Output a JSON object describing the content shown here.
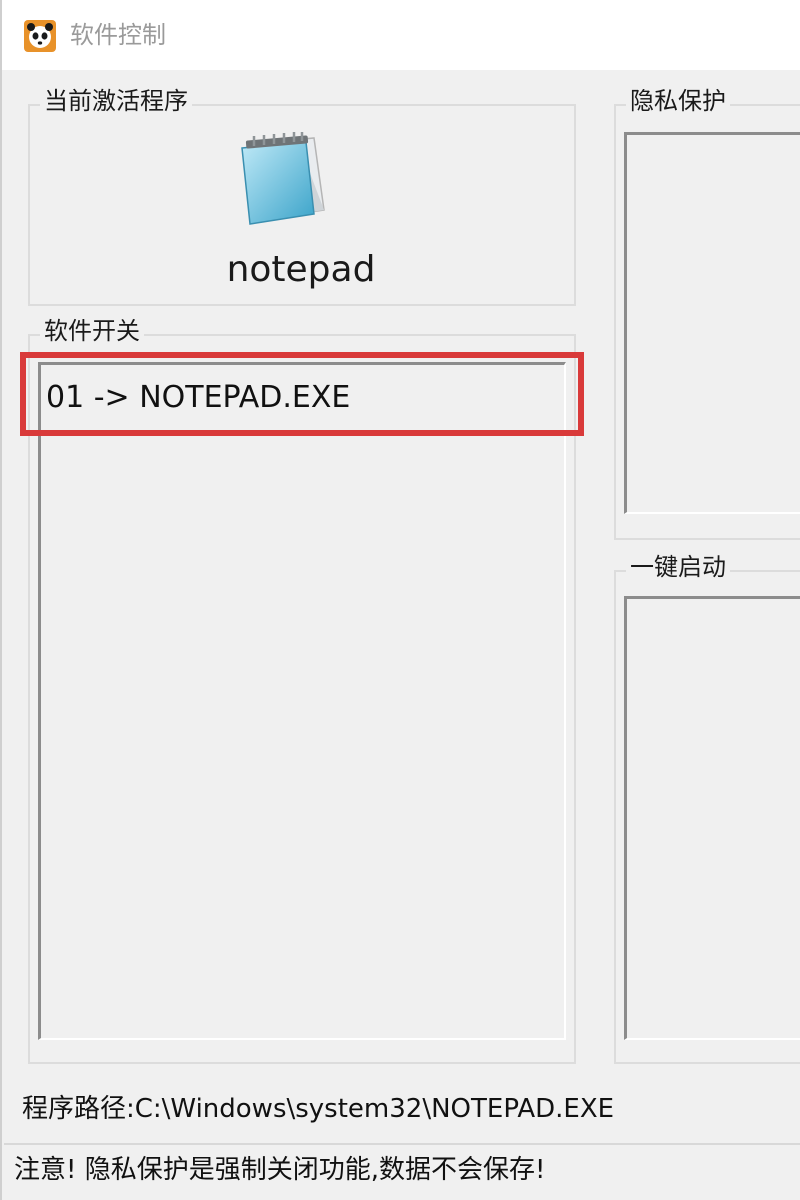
{
  "window": {
    "title": "软件控制",
    "icon": "panda-logo-icon"
  },
  "current_program": {
    "group_label": "当前激活程序",
    "icon": "notepad-icon",
    "name": "notepad"
  },
  "software_switch": {
    "group_label": "软件开关",
    "items": [
      "01 -> NOTEPAD.EXE"
    ],
    "highlight_color": "#d93a3a"
  },
  "privacy_protection": {
    "group_label": "隐私保护"
  },
  "one_click_start": {
    "group_label": "一键启动"
  },
  "status": {
    "path": "程序路径:C:\\Windows\\system32\\NOTEPAD.EXE",
    "notice": "注意! 隐私保护是强制关闭功能,数据不会保存!"
  }
}
